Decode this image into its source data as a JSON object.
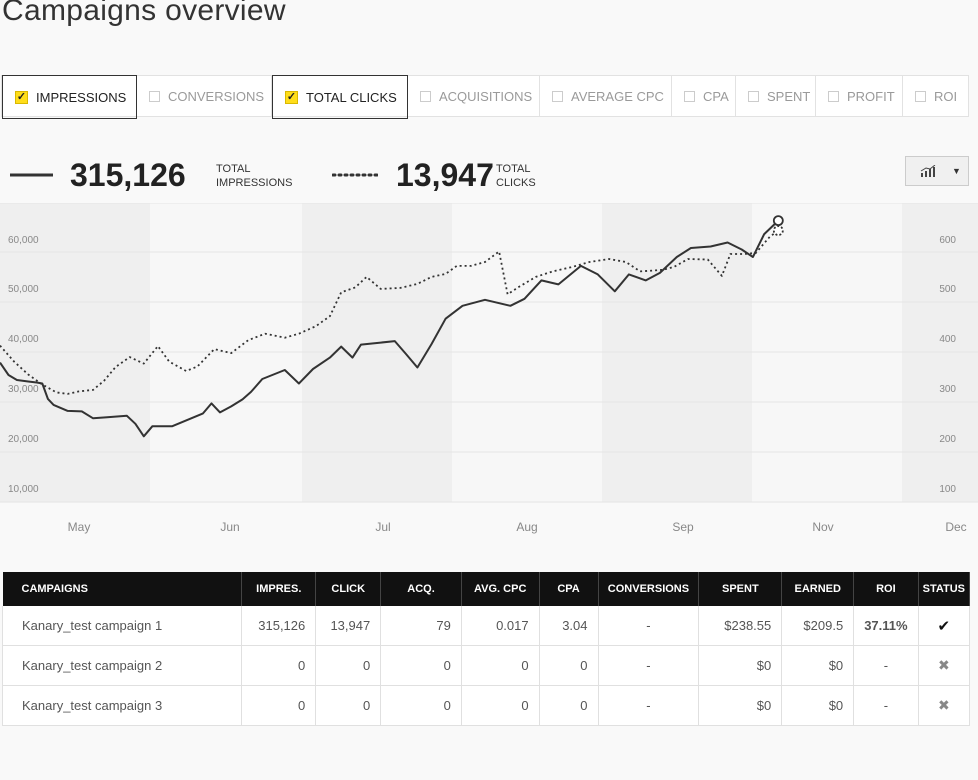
{
  "page": {
    "title": "Campaigns overview"
  },
  "tabs": [
    {
      "label": "IMPRESSIONS",
      "checked": true
    },
    {
      "label": "CONVERSIONS",
      "checked": false
    },
    {
      "label": "TOTAL CLICKS",
      "checked": true
    },
    {
      "label": "ACQUISITIONS",
      "checked": false
    },
    {
      "label": "AVERAGE CPC",
      "checked": false
    },
    {
      "label": "CPA",
      "checked": false
    },
    {
      "label": "SPENT",
      "checked": false
    },
    {
      "label": "PROFIT",
      "checked": false
    },
    {
      "label": "ROI",
      "checked": false
    }
  ],
  "summary": {
    "impressions_value": "315,126",
    "impressions_label_1": "TOTAL",
    "impressions_label_2": "IMPRESSIONS",
    "clicks_value": "13,947",
    "clicks_label_1": "TOTAL",
    "clicks_label_2": "CLICKS"
  },
  "chart_switch": {
    "icon": "bar-line-chart-icon"
  },
  "chart_data": {
    "type": "line",
    "x_labels": [
      "May",
      "Jun",
      "Jul",
      "Aug",
      "Sep",
      "Nov",
      "Dec"
    ],
    "y_left_ticks": [
      "10,000",
      "20,000",
      "30,000",
      "40,000",
      "50,000",
      "60,000"
    ],
    "y_right_ticks": [
      "100",
      "200",
      "300",
      "400",
      "500",
      "600"
    ],
    "y_left_range": [
      0,
      60000
    ],
    "y_right_range": [
      0,
      600
    ],
    "series": [
      {
        "style": "solid",
        "axis": "left",
        "points": [
          [
            0,
            28000
          ],
          [
            0.3,
            25500
          ],
          [
            0.6,
            24500
          ],
          [
            1.0,
            24200
          ],
          [
            1.3,
            24000
          ],
          [
            1.5,
            23800
          ],
          [
            1.7,
            20700
          ],
          [
            1.9,
            19500
          ],
          [
            2.4,
            18300
          ],
          [
            2.9,
            18200
          ],
          [
            3.3,
            16800
          ],
          [
            3.8,
            17000
          ],
          [
            4.5,
            17300
          ],
          [
            4.8,
            15700
          ],
          [
            5.1,
            13200
          ],
          [
            5.4,
            15200
          ],
          [
            6.1,
            15200
          ],
          [
            7.2,
            17800
          ],
          [
            7.5,
            19800
          ],
          [
            7.8,
            18000
          ],
          [
            8.2,
            19200
          ],
          [
            8.6,
            20600
          ],
          [
            8.9,
            22100
          ],
          [
            9.3,
            24700
          ],
          [
            10.1,
            26500
          ],
          [
            10.6,
            23800
          ],
          [
            11.1,
            26700
          ],
          [
            11.7,
            29000
          ],
          [
            12.1,
            31200
          ],
          [
            12.5,
            29000
          ],
          [
            12.8,
            31600
          ],
          [
            13.5,
            32000
          ],
          [
            14.0,
            32300
          ],
          [
            14.4,
            29700
          ],
          [
            14.8,
            27000
          ],
          [
            15.3,
            31700
          ],
          [
            15.8,
            36800
          ],
          [
            16.4,
            39400
          ],
          [
            17.2,
            40600
          ],
          [
            18.1,
            39400
          ],
          [
            18.6,
            40800
          ],
          [
            19.2,
            44500
          ],
          [
            19.8,
            43700
          ],
          [
            20.6,
            47400
          ],
          [
            21.2,
            45700
          ],
          [
            21.8,
            42300
          ],
          [
            22.3,
            45700
          ],
          [
            22.9,
            44500
          ],
          [
            23.4,
            46000
          ],
          [
            24.0,
            49200
          ],
          [
            24.5,
            51000
          ],
          [
            25.2,
            51300
          ],
          [
            25.8,
            52100
          ],
          [
            26.3,
            50700
          ],
          [
            26.7,
            49200
          ],
          [
            27.1,
            53800
          ],
          [
            27.6,
            56500
          ]
        ],
        "end_marker": [
          27.6,
          56500
        ]
      },
      {
        "style": "dotted",
        "axis": "left",
        "points": [
          [
            0,
            31400
          ],
          [
            0.5,
            28200
          ],
          [
            1.0,
            25600
          ],
          [
            1.5,
            23600
          ],
          [
            2.0,
            22000
          ],
          [
            2.4,
            21700
          ],
          [
            2.8,
            22200
          ],
          [
            3.3,
            22500
          ],
          [
            3.7,
            24400
          ],
          [
            4.1,
            27100
          ],
          [
            4.6,
            29100
          ],
          [
            5.1,
            27800
          ],
          [
            5.6,
            31300
          ],
          [
            6.0,
            28200
          ],
          [
            6.6,
            26300
          ],
          [
            7.0,
            27200
          ],
          [
            7.6,
            30700
          ],
          [
            8.2,
            29900
          ],
          [
            8.8,
            32500
          ],
          [
            9.4,
            33800
          ],
          [
            10.1,
            33000
          ],
          [
            10.6,
            33800
          ],
          [
            11.2,
            35300
          ],
          [
            11.7,
            37300
          ],
          [
            12.1,
            42100
          ],
          [
            12.6,
            43100
          ],
          [
            13.0,
            45200
          ],
          [
            13.5,
            42800
          ],
          [
            14.2,
            43000
          ],
          [
            14.8,
            43800
          ],
          [
            15.3,
            45200
          ],
          [
            15.8,
            45800
          ],
          [
            16.2,
            47400
          ],
          [
            16.7,
            47400
          ],
          [
            17.2,
            48200
          ],
          [
            17.7,
            50300
          ],
          [
            18.0,
            41700
          ],
          [
            18.4,
            43200
          ],
          [
            19.0,
            45200
          ],
          [
            19.6,
            46300
          ],
          [
            20.3,
            47200
          ],
          [
            20.9,
            48200
          ],
          [
            21.6,
            48800
          ],
          [
            22.2,
            48200
          ],
          [
            22.7,
            46300
          ],
          [
            23.5,
            46600
          ],
          [
            23.9,
            47200
          ],
          [
            24.4,
            48800
          ],
          [
            25.1,
            48700
          ],
          [
            25.6,
            45400
          ],
          [
            25.9,
            49800
          ],
          [
            26.4,
            49800
          ],
          [
            26.8,
            50000
          ],
          [
            27.3,
            53300
          ],
          [
            27.6,
            54500
          ]
        ],
        "end_marker": [
          27.6,
          54500
        ]
      }
    ]
  },
  "table": {
    "headers": [
      "CAMPAIGNS",
      "IMPRES.",
      "CLICK",
      "ACQ.",
      "AVG. CPC",
      "CPA",
      "CONVERSIONS",
      "SPENT",
      "EARNED",
      "ROI",
      "STATUS"
    ],
    "rows": [
      {
        "name": "Kanary_test campaign 1",
        "impressions": "315,126",
        "clicks": "13,947",
        "acq": "79",
        "avg_cpc": "0.017",
        "cpa": "3.04",
        "conversions": "-",
        "spent": "$238.55",
        "earned": "$209.5",
        "roi": "37.11%",
        "status": "✔",
        "active": true
      },
      {
        "name": "Kanary_test campaign 2",
        "impressions": "0",
        "clicks": "0",
        "acq": "0",
        "avg_cpc": "0",
        "cpa": "0",
        "conversions": "-",
        "spent": "$0",
        "earned": "$0",
        "roi": "-",
        "status": "✖",
        "active": false
      },
      {
        "name": "Kanary_test campaign 3",
        "impressions": "0",
        "clicks": "0",
        "acq": "0",
        "avg_cpc": "0",
        "cpa": "0",
        "conversions": "-",
        "spent": "$0",
        "earned": "$0",
        "roi": "-",
        "status": "✖",
        "active": false
      }
    ]
  }
}
